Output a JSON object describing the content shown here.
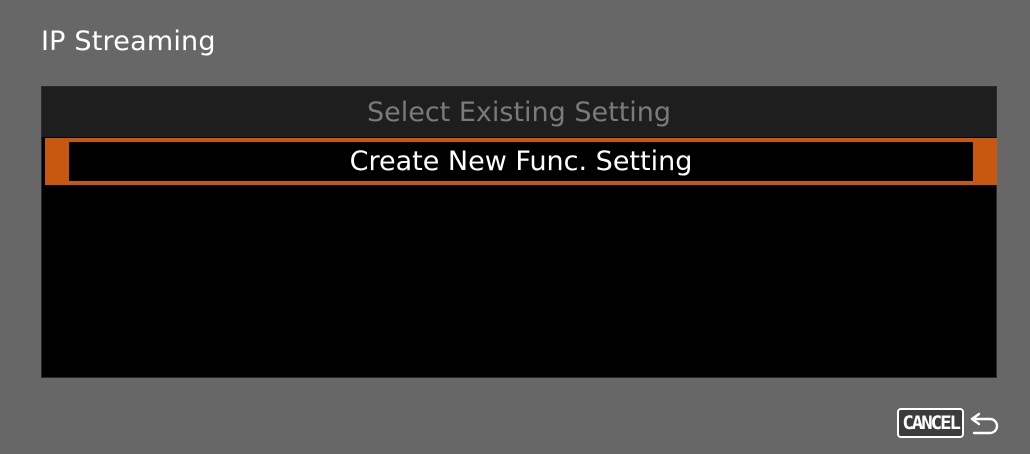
{
  "screen": {
    "title": "IP Streaming"
  },
  "menu": {
    "header_label": "Select Existing Setting",
    "items": [
      {
        "label": "Create New Func. Setting",
        "selected": true
      }
    ]
  },
  "footer": {
    "cancel_label": "CANCEL",
    "back_icon": "return-arrow-icon"
  },
  "colors": {
    "background": "#676767",
    "panel": "#000000",
    "header_bar": "#1e1e1e",
    "highlight": "#c8580f",
    "dim_text": "#7a7a7a",
    "text": "#ffffff"
  }
}
